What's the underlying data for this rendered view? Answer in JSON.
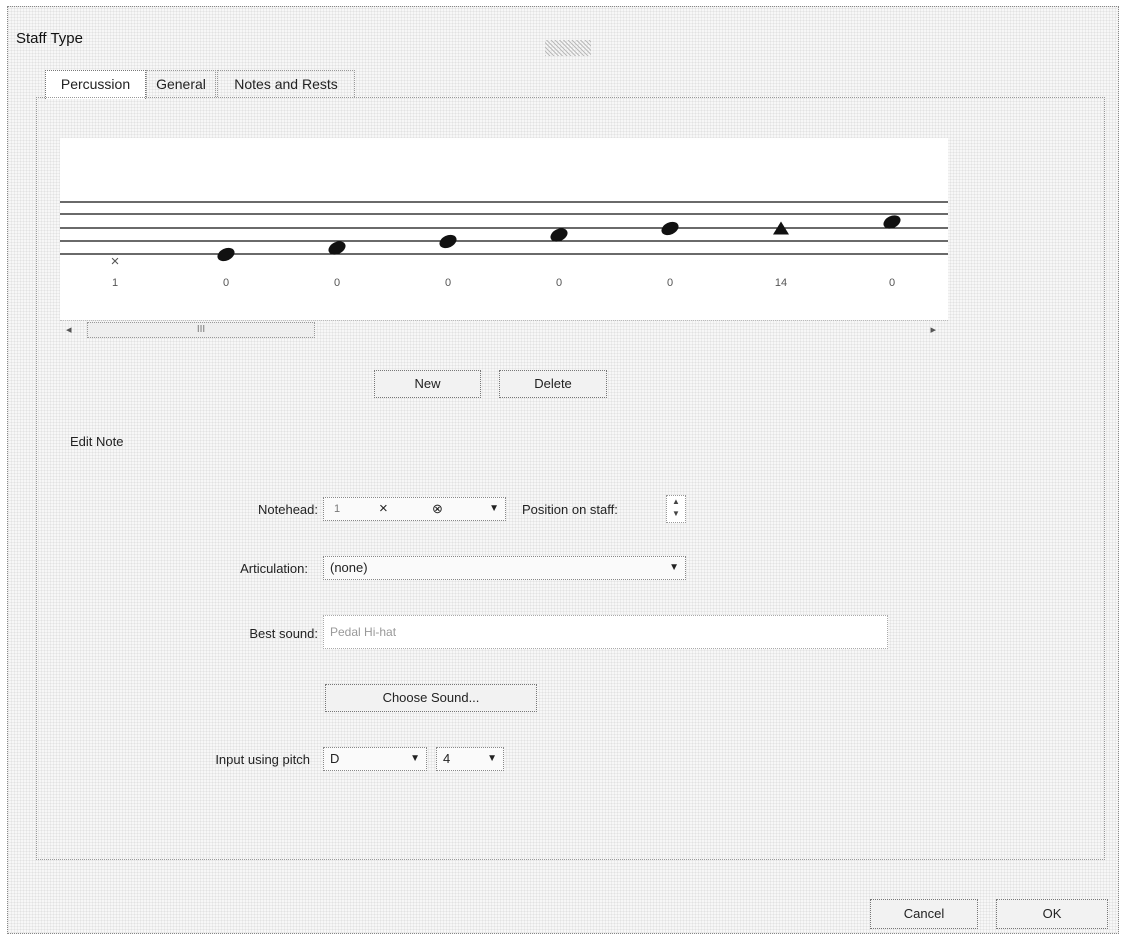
{
  "window": {
    "title": "Staff Type"
  },
  "tabs": [
    {
      "label": "Percussion",
      "active": true
    },
    {
      "label": "General",
      "active": false
    },
    {
      "label": "Notes and Rests",
      "active": false
    }
  ],
  "staff": {
    "notes": [
      {
        "label": "1",
        "head": "x",
        "position": 0
      },
      {
        "label": "0",
        "head": "normal",
        "position": 1
      },
      {
        "label": "0",
        "head": "normal",
        "position": 2
      },
      {
        "label": "0",
        "head": "normal",
        "position": 3
      },
      {
        "label": "0",
        "head": "normal",
        "position": 4
      },
      {
        "label": "0",
        "head": "normal",
        "position": 5
      },
      {
        "label": "14",
        "head": "triangle",
        "position": 5
      },
      {
        "label": "0",
        "head": "normal",
        "position": 6
      }
    ],
    "scroll_label": "III"
  },
  "buttons": {
    "new": "New",
    "delete": "Delete",
    "choose_sound": "Choose Sound...",
    "cancel": "Cancel",
    "ok": "OK"
  },
  "edit_note": {
    "section_title": "Edit Note",
    "notehead_label": "Notehead:",
    "notehead_options": [
      "1",
      "×",
      "⊗"
    ],
    "position_label": "Position on staff:",
    "articulation_label": "Articulation:",
    "articulation_value": "(none)",
    "best_sound_label": "Best sound:",
    "best_sound_value": "Pedal Hi-hat",
    "input_pitch_label": "Input using pitch",
    "pitch_note": "D",
    "pitch_octave": "4"
  },
  "icons": {
    "dropdown": "▼",
    "scroll_left": "◂",
    "scroll_right": "▸",
    "spin_up": "▲",
    "spin_down": "▼"
  }
}
